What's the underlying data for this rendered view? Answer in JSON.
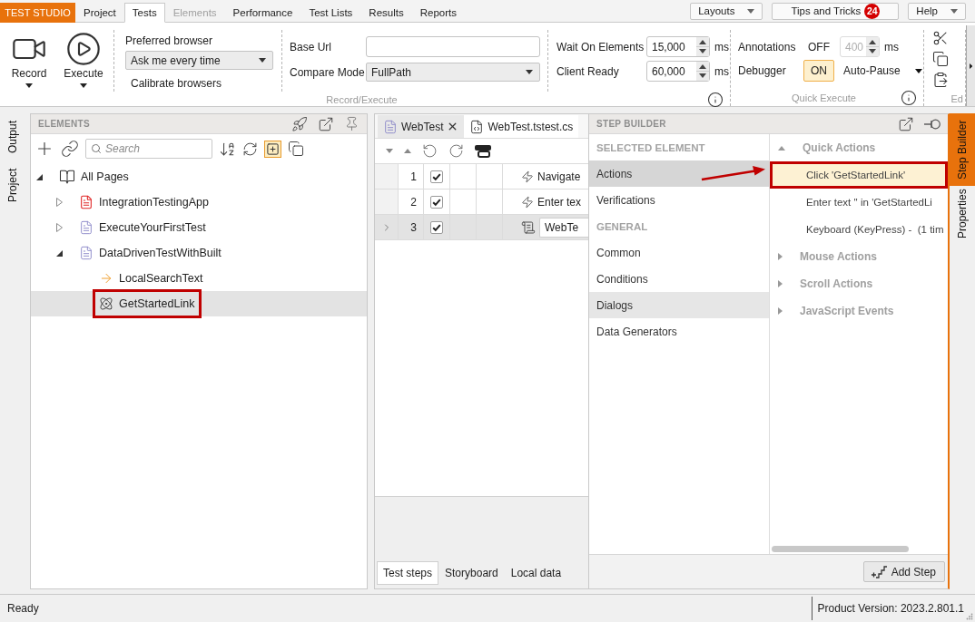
{
  "app": {
    "brand": "TEST STUDIO"
  },
  "menu_tabs": [
    {
      "label": "Project",
      "selected": false,
      "disabled": false
    },
    {
      "label": "Tests",
      "selected": true,
      "disabled": false
    },
    {
      "label": "Elements",
      "selected": false,
      "disabled": true
    },
    {
      "label": "Performance",
      "selected": false,
      "disabled": false
    },
    {
      "label": "Test Lists",
      "selected": false,
      "disabled": false
    },
    {
      "label": "Results",
      "selected": false,
      "disabled": false
    },
    {
      "label": "Reports",
      "selected": false,
      "disabled": false
    }
  ],
  "top_buttons": [
    {
      "kind": "dropdown",
      "label": "Layouts"
    },
    {
      "kind": "badge",
      "label": "Tips and Tricks",
      "badge": "24"
    },
    {
      "kind": "dropdown",
      "label": "Help"
    }
  ],
  "ribbon": {
    "record_execute": {
      "label": "Record/Execute",
      "big_buttons": [
        {
          "kind": "record",
          "label": "Record"
        },
        {
          "kind": "execute",
          "label": "Execute"
        }
      ],
      "preferred_browser": {
        "label": "Preferred browser",
        "value": "Ask me every time",
        "action": "Calibrate browsers"
      },
      "base_url": {
        "label": "Base Url"
      },
      "compare_mode": {
        "label": "Compare Mode",
        "value": "FullPath"
      },
      "timeouts": [
        {
          "label": "Wait On Elements",
          "value": "15,000",
          "unit": "ms"
        },
        {
          "label": "Client Ready",
          "value": "60,000",
          "unit": "ms"
        }
      ]
    },
    "quick_execute": {
      "label": "Quick Execute",
      "annotations": {
        "label": "Annotations",
        "toggle": "OFF",
        "on": false,
        "value": "400",
        "unit": "ms",
        "disabled": true
      },
      "debugger": {
        "label": "Debugger",
        "toggle": "ON",
        "on": true,
        "option": "Auto-Pause"
      }
    },
    "edit": {
      "label": "Ed"
    }
  },
  "left_side_tabs": [
    {
      "label": "Output",
      "selected": false
    },
    {
      "label": "Project",
      "selected": false
    }
  ],
  "elements_panel": {
    "title": "ELEMENTS",
    "search": {
      "placeholder": "Search"
    },
    "toolbar_toggle": {
      "on": true
    },
    "tree": [
      {
        "label": "All Pages",
        "kind": "pages",
        "expanded": true,
        "selected": false,
        "outlined": false,
        "children": [
          {
            "label": "IntegrationTestingApp",
            "kind": "error-page",
            "expanded": false,
            "selected": false,
            "outlined": false
          },
          {
            "label": "ExecuteYourFirstTest",
            "kind": "page",
            "expanded": false,
            "selected": false,
            "outlined": false
          },
          {
            "label": "DataDrivenTestWithBuilt",
            "kind": "page",
            "expanded": true,
            "selected": false,
            "outlined": false,
            "children": [
              {
                "label": "LocalSearchText",
                "kind": "input-element",
                "selected": false,
                "outlined": false
              },
              {
                "label": "GetStartedLink",
                "kind": "link-element",
                "selected": true,
                "outlined": true
              }
            ]
          }
        ]
      }
    ]
  },
  "editor": {
    "tabs": [
      {
        "label": "WebTest",
        "kind": "test",
        "selected": true
      },
      {
        "label": "WebTest.tstest.cs",
        "kind": "code",
        "selected": false
      }
    ],
    "steps": [
      {
        "number": "1",
        "checked": true,
        "kind": "action",
        "text": "Navigate",
        "selected": false
      },
      {
        "number": "2",
        "checked": true,
        "kind": "action",
        "text": "Enter tex",
        "selected": false
      },
      {
        "number": "3",
        "checked": true,
        "kind": "test",
        "text": "WebTe",
        "selected": true
      }
    ],
    "bottom_tabs": [
      {
        "label": "Test steps",
        "selected": true
      },
      {
        "label": "Storyboard",
        "selected": false
      },
      {
        "label": "Local data",
        "selected": false
      }
    ]
  },
  "step_builder": {
    "title": "STEP BUILDER",
    "categories": [
      {
        "kind": "header",
        "label": "SELECTED ELEMENT"
      },
      {
        "kind": "item",
        "label": "Actions",
        "selected": true,
        "hovered": false
      },
      {
        "kind": "item",
        "label": "Verifications",
        "selected": false,
        "hovered": false
      },
      {
        "kind": "header",
        "label": "GENERAL"
      },
      {
        "kind": "item",
        "label": "Common",
        "selected": false,
        "hovered": false
      },
      {
        "kind": "item",
        "label": "Conditions",
        "selected": false,
        "hovered": false
      },
      {
        "kind": "item",
        "label": "Dialogs",
        "selected": false,
        "hovered": true
      },
      {
        "kind": "item",
        "label": "Data Generators",
        "selected": false,
        "hovered": false
      }
    ],
    "groups": [
      {
        "label": "Quick Actions",
        "expanded": true,
        "items": [
          {
            "label": "Click 'GetStartedLink'",
            "selected": true,
            "outlined": true
          },
          {
            "label": "Enter text '' in 'GetStartedLi",
            "selected": false,
            "outlined": false
          },
          {
            "label": "Keyboard (KeyPress) -  (1 tim",
            "selected": false,
            "outlined": false
          }
        ]
      },
      {
        "label": "Mouse Actions",
        "expanded": false
      },
      {
        "label": "Scroll Actions",
        "expanded": false
      },
      {
        "label": "JavaScript Events",
        "expanded": false
      }
    ],
    "add_step": "Add Step"
  },
  "right_side_tabs": [
    {
      "label": "Step Builder",
      "selected": true
    },
    {
      "label": "Properties",
      "selected": false
    }
  ],
  "status_bar": {
    "status": "Ready",
    "version": "Product Version: 2023.2.801.1"
  }
}
